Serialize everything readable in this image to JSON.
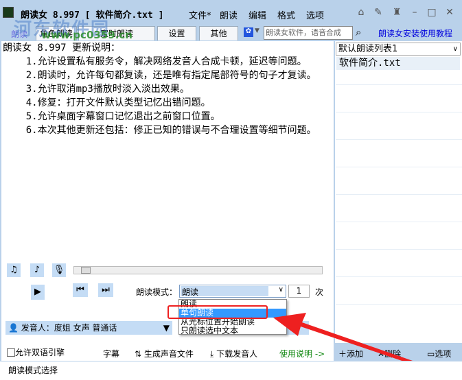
{
  "title": "朗读女 8.997 [ 软件简介.txt ]",
  "menu": [
    "文件*",
    "朗读",
    "编辑",
    "格式",
    "选项"
  ],
  "watermark": {
    "name": "河东软件园",
    "url": "www.pc0359.cn"
  },
  "tabs": {
    "active": "朗读",
    "items": [
      "角色朗读",
      "定时朗读",
      "设置",
      "其他"
    ]
  },
  "search_placeholder": "朗读女软件，语音合成",
  "help_link": "朗读女安装使用教程",
  "editor_lines": [
    "朗读女 8.997 更新说明：",
    "    1.允许设置私有服务令，解决网络发音人合成卡顿，延迟等问题。",
    "    2.朗读时，允许每句都复读，还是唯有指定尾部符号的句子才复读。",
    "    3.允许取消mp3播放时淡入淡出效果。",
    "    4.修复：打开文件默认类型记忆出错问题。",
    "    5.允许桌面字幕窗口记忆退出之前窗口位置。",
    "    6.本次其他更新还包括：修正已知的错误与不合理设置等细节问题。"
  ],
  "playlist": {
    "selected": "默认朗读列表1",
    "items": [
      "软件简介.txt"
    ]
  },
  "mode": {
    "label": "朗读模式：",
    "value": "朗读",
    "repeat": "1",
    "repeat_unit": "次",
    "options": [
      "朗读",
      "单句朗读",
      "从光标位置开始朗读",
      "只朗读选中文本"
    ],
    "highlighted": "单句朗读"
  },
  "speaker": "发音人：度姐 女声 普通话",
  "bottom": {
    "bilingual": "允许双语引擎",
    "subtitle": "字幕",
    "generate": "生成声音文件",
    "download": "下载发音人",
    "help": "使用说明 ->"
  },
  "right_buttons": {
    "add": "添加",
    "delete": "删除",
    "options": "选项"
  },
  "status": "朗读模式选择"
}
